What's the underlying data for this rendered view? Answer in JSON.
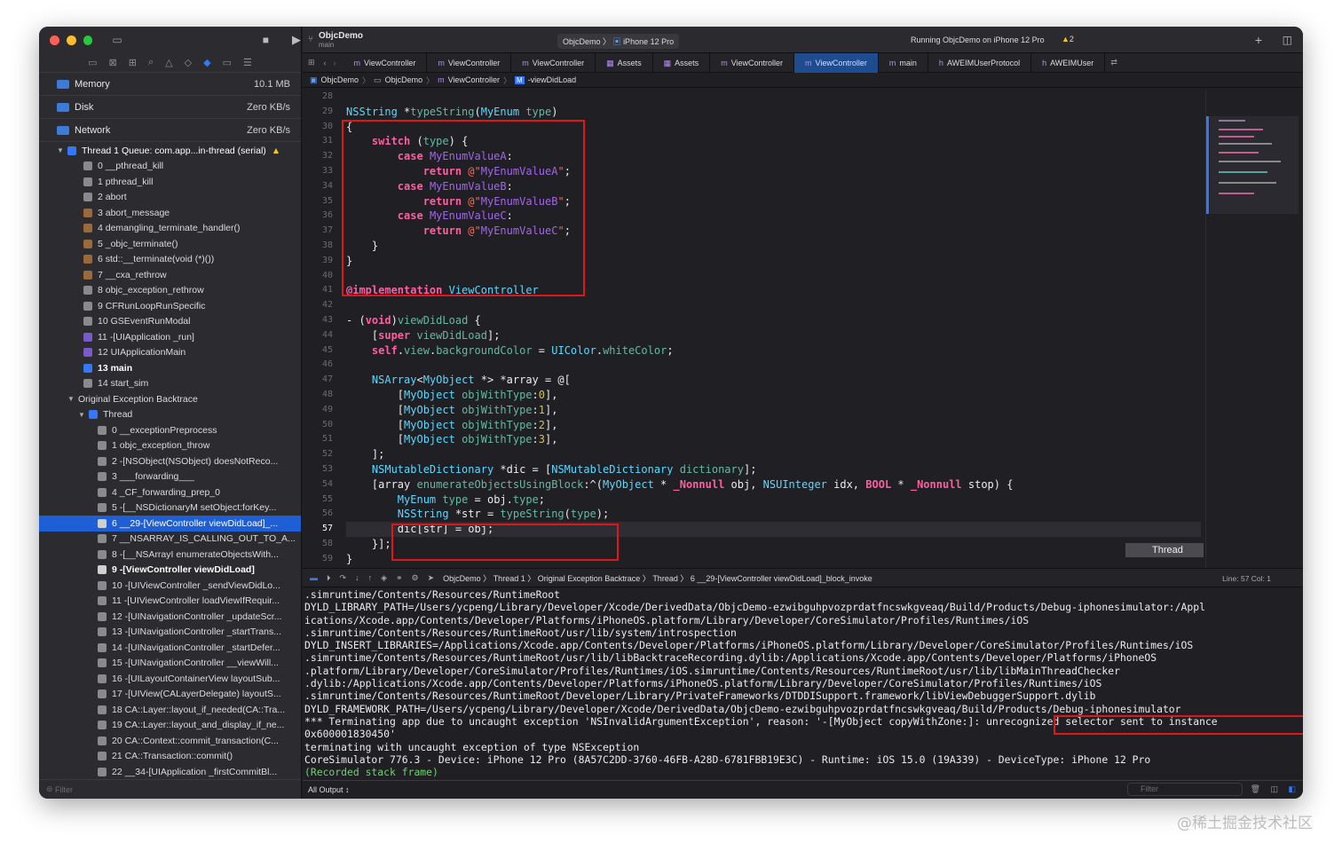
{
  "titlebar": {
    "project": "ObjcDemo",
    "subtitle": "main",
    "scheme_target": "ObjcDemo",
    "scheme_device": "iPhone 12 Pro",
    "status": "Running ObjcDemo on iPhone 12 Pro",
    "warnings": "2"
  },
  "gauges": [
    {
      "label": "Memory",
      "value": "10.1 MB"
    },
    {
      "label": "Disk",
      "value": "Zero KB/s"
    },
    {
      "label": "Network",
      "value": "Zero KB/s"
    }
  ],
  "thread_header": "Thread 1 Queue: com.app...in-thread (serial)",
  "frames": [
    "0 __pthread_kill",
    "1 pthread_kill",
    "2 abort",
    "3 abort_message",
    "4 demangling_terminate_handler()",
    "5 _objc_terminate()",
    "6 std::__terminate(void (*)())",
    "7 __cxa_rethrow",
    "8 objc_exception_rethrow",
    "9 CFRunLoopRunSpecific",
    "10 GSEventRunModal",
    "11 -[UIApplication _run]",
    "12 UIApplicationMain",
    "13 main",
    "14 start_sim"
  ],
  "backtrace_header": "Original Exception Backtrace",
  "backtrace_thread": "Thread",
  "backtrace_frames": [
    "0 __exceptionPreprocess",
    "1 objc_exception_throw",
    "2 -[NSObject(NSObject) doesNotReco...",
    "3 ___forwarding___",
    "4 _CF_forwarding_prep_0",
    "5 -[__NSDictionaryM setObject:forKey...",
    "6 __29-[ViewController viewDidLoad]_...",
    "7 __NSARRAY_IS_CALLING_OUT_TO_A...",
    "8 -[__NSArrayI enumerateObjectsWith...",
    "9 -[ViewController viewDidLoad]",
    "10 -[UIViewController _sendViewDidLo...",
    "11 -[UIViewController loadViewIfRequir...",
    "12 -[UINavigationController _updateScr...",
    "13 -[UINavigationController _startTrans...",
    "14 -[UINavigationController _startDefer...",
    "15 -[UINavigationController __viewWill...",
    "16 -[UILayoutContainerView layoutSub...",
    "17 -[UIView(CALayerDelegate) layoutS...",
    "18 CA::Layer::layout_if_needed(CA::Tra...",
    "19 CA::Layer::layout_and_display_if_ne...",
    "20 CA::Context::commit_transaction(C...",
    "21 CA::Transaction::commit()",
    "22 __34-[UIApplication _firstCommitBl..."
  ],
  "left_filter_placeholder": "Filter",
  "tabs": [
    "ViewController",
    "ViewController",
    "ViewController",
    "Assets",
    "Assets",
    "ViewController",
    "ViewController",
    "main",
    "AWEIMUserProtocol",
    "AWEIMUser"
  ],
  "jumpbar": [
    "ObjcDemo",
    "ObjcDemo",
    "ViewController",
    "-viewDidLoad"
  ],
  "code_lines": [
    {
      "n": "28",
      "t": ""
    },
    {
      "n": "29",
      "t": "NSString *typeString(MyEnum type)"
    },
    {
      "n": "30",
      "t": "{"
    },
    {
      "n": "31",
      "t": "    switch (type) {"
    },
    {
      "n": "32",
      "t": "        case MyEnumValueA:"
    },
    {
      "n": "33",
      "t": "            return @\"MyEnumValueA\";"
    },
    {
      "n": "34",
      "t": "        case MyEnumValueB:"
    },
    {
      "n": "35",
      "t": "            return @\"MyEnumValueB\";"
    },
    {
      "n": "36",
      "t": "        case MyEnumValueC:"
    },
    {
      "n": "37",
      "t": "            return @\"MyEnumValueC\";"
    },
    {
      "n": "38",
      "t": "    }"
    },
    {
      "n": "39",
      "t": "}"
    },
    {
      "n": "40",
      "t": ""
    },
    {
      "n": "41",
      "t": "@implementation ViewController"
    },
    {
      "n": "42",
      "t": ""
    },
    {
      "n": "43",
      "t": "- (void)viewDidLoad {"
    },
    {
      "n": "44",
      "t": "    [super viewDidLoad];"
    },
    {
      "n": "45",
      "t": "    self.view.backgroundColor = UIColor.whiteColor;"
    },
    {
      "n": "46",
      "t": ""
    },
    {
      "n": "47",
      "t": "    NSArray<MyObject *> *array = @["
    },
    {
      "n": "48",
      "t": "        [MyObject objWithType:0],"
    },
    {
      "n": "49",
      "t": "        [MyObject objWithType:1],"
    },
    {
      "n": "50",
      "t": "        [MyObject objWithType:2],"
    },
    {
      "n": "51",
      "t": "        [MyObject objWithType:3],"
    },
    {
      "n": "52",
      "t": "    ];"
    },
    {
      "n": "53",
      "t": "    NSMutableDictionary *dic = [NSMutableDictionary dictionary];"
    },
    {
      "n": "54",
      "t": "    [array enumerateObjectsUsingBlock:^(MyObject * _Nonnull obj, NSUInteger idx, BOOL * _Nonnull stop) {"
    },
    {
      "n": "55",
      "t": "        MyEnum type = obj.type;"
    },
    {
      "n": "56",
      "t": "        NSString *str = typeString(type);"
    },
    {
      "n": "57",
      "t": "        dic[str] = obj;"
    },
    {
      "n": "58",
      "t": "    }];"
    },
    {
      "n": "59",
      "t": "}"
    }
  ],
  "thread_marker": "Thread",
  "debugbar": {
    "path": [
      "ObjcDemo",
      "Thread 1",
      "Original Exception Backtrace",
      "Thread",
      "6 __29-[ViewController viewDidLoad]_block_invoke"
    ],
    "linecol": "Line: 57  Col: 1"
  },
  "console_lines": [
    ".simruntime/Contents/Resources/RuntimeRoot",
    "DYLD_LIBRARY_PATH=/Users/ycpeng/Library/Developer/Xcode/DerivedData/ObjcDemo-ezwibguhpvozprdatfncswkgveaq/Build/Products/Debug-iphonesimulator:/Appl",
    "ications/Xcode.app/Contents/Developer/Platforms/iPhoneOS.platform/Library/Developer/CoreSimulator/Profiles/Runtimes/iOS",
    ".simruntime/Contents/Resources/RuntimeRoot/usr/lib/system/introspection",
    "DYLD_INSERT_LIBRARIES=/Applications/Xcode.app/Contents/Developer/Platforms/iPhoneOS.platform/Library/Developer/CoreSimulator/Profiles/Runtimes/iOS",
    ".simruntime/Contents/Resources/RuntimeRoot/usr/lib/libBacktraceRecording.dylib:/Applications/Xcode.app/Contents/Developer/Platforms/iPhoneOS",
    ".platform/Library/Developer/CoreSimulator/Profiles/Runtimes/iOS.simruntime/Contents/Resources/RuntimeRoot/usr/lib/libMainThreadChecker",
    ".dylib:/Applications/Xcode.app/Contents/Developer/Platforms/iPhoneOS.platform/Library/Developer/CoreSimulator/Profiles/Runtimes/iOS",
    ".simruntime/Contents/Resources/RuntimeRoot/Developer/Library/PrivateFrameworks/DTDDISupport.framework/libViewDebuggerSupport.dylib",
    "DYLD_FRAMEWORK_PATH=/Users/ycpeng/Library/Developer/Xcode/DerivedData/ObjcDemo-ezwibguhpvozprdatfncswkgveaq/Build/Products/Debug-iphonesimulator",
    "*** Terminating app due to uncaught exception 'NSInvalidArgumentException', reason: '-[MyObject copyWithZone:]: unrecognized selector sent to instance",
    "0x600001830450'",
    "terminating with uncaught exception of type NSException",
    "CoreSimulator 776.3 - Device: iPhone 12 Pro (8A57C2DD-3760-46FB-A28D-6781FBB19E3C) - Runtime: iOS 15.0 (19A339) - DeviceType: iPhone 12 Pro",
    "(Recorded stack frame)"
  ],
  "output_selector": "All Output ↕",
  "console_filter_placeholder": "Filter",
  "watermark": "@稀土掘金技术社区"
}
